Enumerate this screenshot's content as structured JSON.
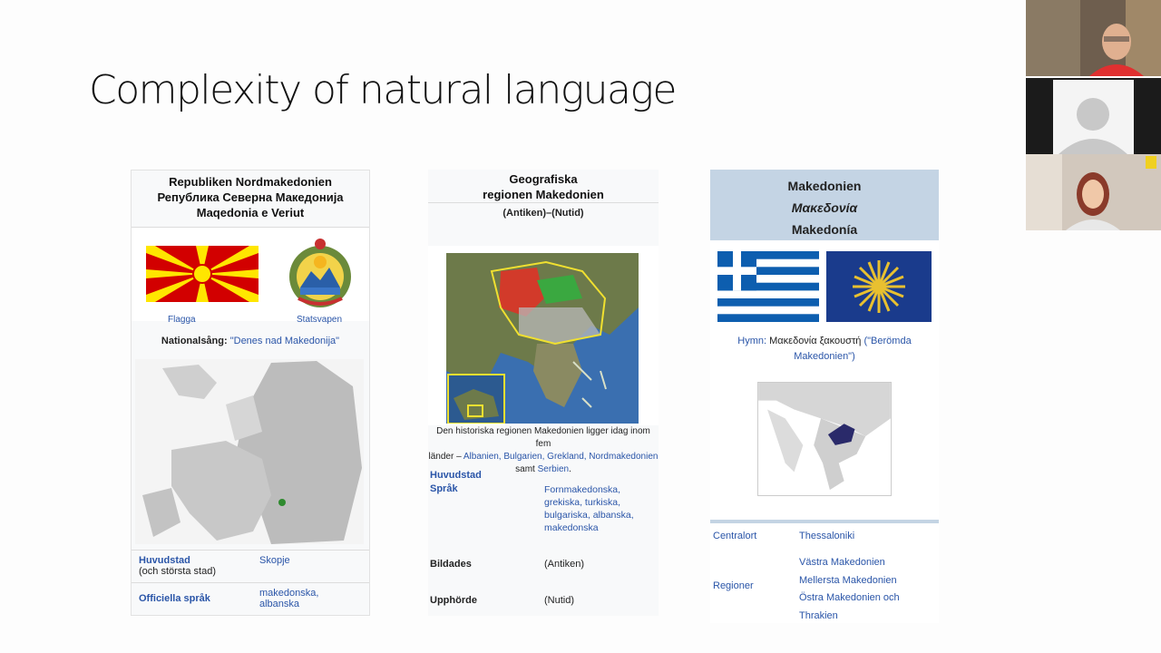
{
  "slide": {
    "title": "Complexity of natural language"
  },
  "panel1": {
    "title_lines": [
      "Republiken Nordmakedonien",
      "Република Северна Македонија",
      "Maqedonia e Veriut"
    ],
    "flag_caption": "Flagga",
    "coat_caption": "Statsvapen",
    "anthem_label": "Nationalsång:",
    "anthem_value": "\"Denes nad Makedonija\"",
    "rows": [
      {
        "key": "Huvudstad",
        "key2": "(och största stad)",
        "value": "Skopje"
      },
      {
        "key": "Officiella språk",
        "value": "makedonska,",
        "value2": "albanska"
      }
    ]
  },
  "panel2": {
    "title_lines": [
      "Geografiska",
      "regionen Makedonien"
    ],
    "subtitle": "(Antiken)–(Nutid)",
    "desc_line1": "Den historiska regionen Makedonien ligger idag inom fem",
    "desc_line2_prefix": "länder – ",
    "desc_countries": "Albanien, Bulgarien, Grekland, Nordmakedonien",
    "desc_line3_prefix": "samt ",
    "desc_last": "Serbien",
    "desc_end": ".",
    "capital_label": "Huvudstad",
    "language_label": "Språk",
    "languages": [
      "Fornmakedonska,",
      "grekiska, turkiska,",
      "bulgariska, albanska,",
      "makedonska"
    ],
    "formed_label": "Bildades",
    "formed_value": "(Antiken)",
    "ended_label": "Upphörde",
    "ended_value": "(Nutid)"
  },
  "panel3": {
    "title_lines": [
      "Makedonien",
      "Μακεδονία",
      "Makedonía"
    ],
    "hymn_label": "Hymn:",
    "hymn_value": "Μακεδονία ξακουστή",
    "hymn_link1": "(\"Berömda",
    "hymn_link2": "Makedonien\")",
    "centralort_label": "Centralort",
    "centralort_value": "Thessaloniki",
    "regioner_label": "Regioner",
    "regions": [
      "Västra Makedonien",
      "Mellersta Makedonien",
      "Östra Makedonien och",
      "Thrakien"
    ]
  },
  "colors": {
    "link": "#2a55a8",
    "header_blue": "#c4d4e4",
    "mk_red": "#d20000",
    "mk_yellow": "#ffe600",
    "gr_blue": "#0d5eaf"
  }
}
